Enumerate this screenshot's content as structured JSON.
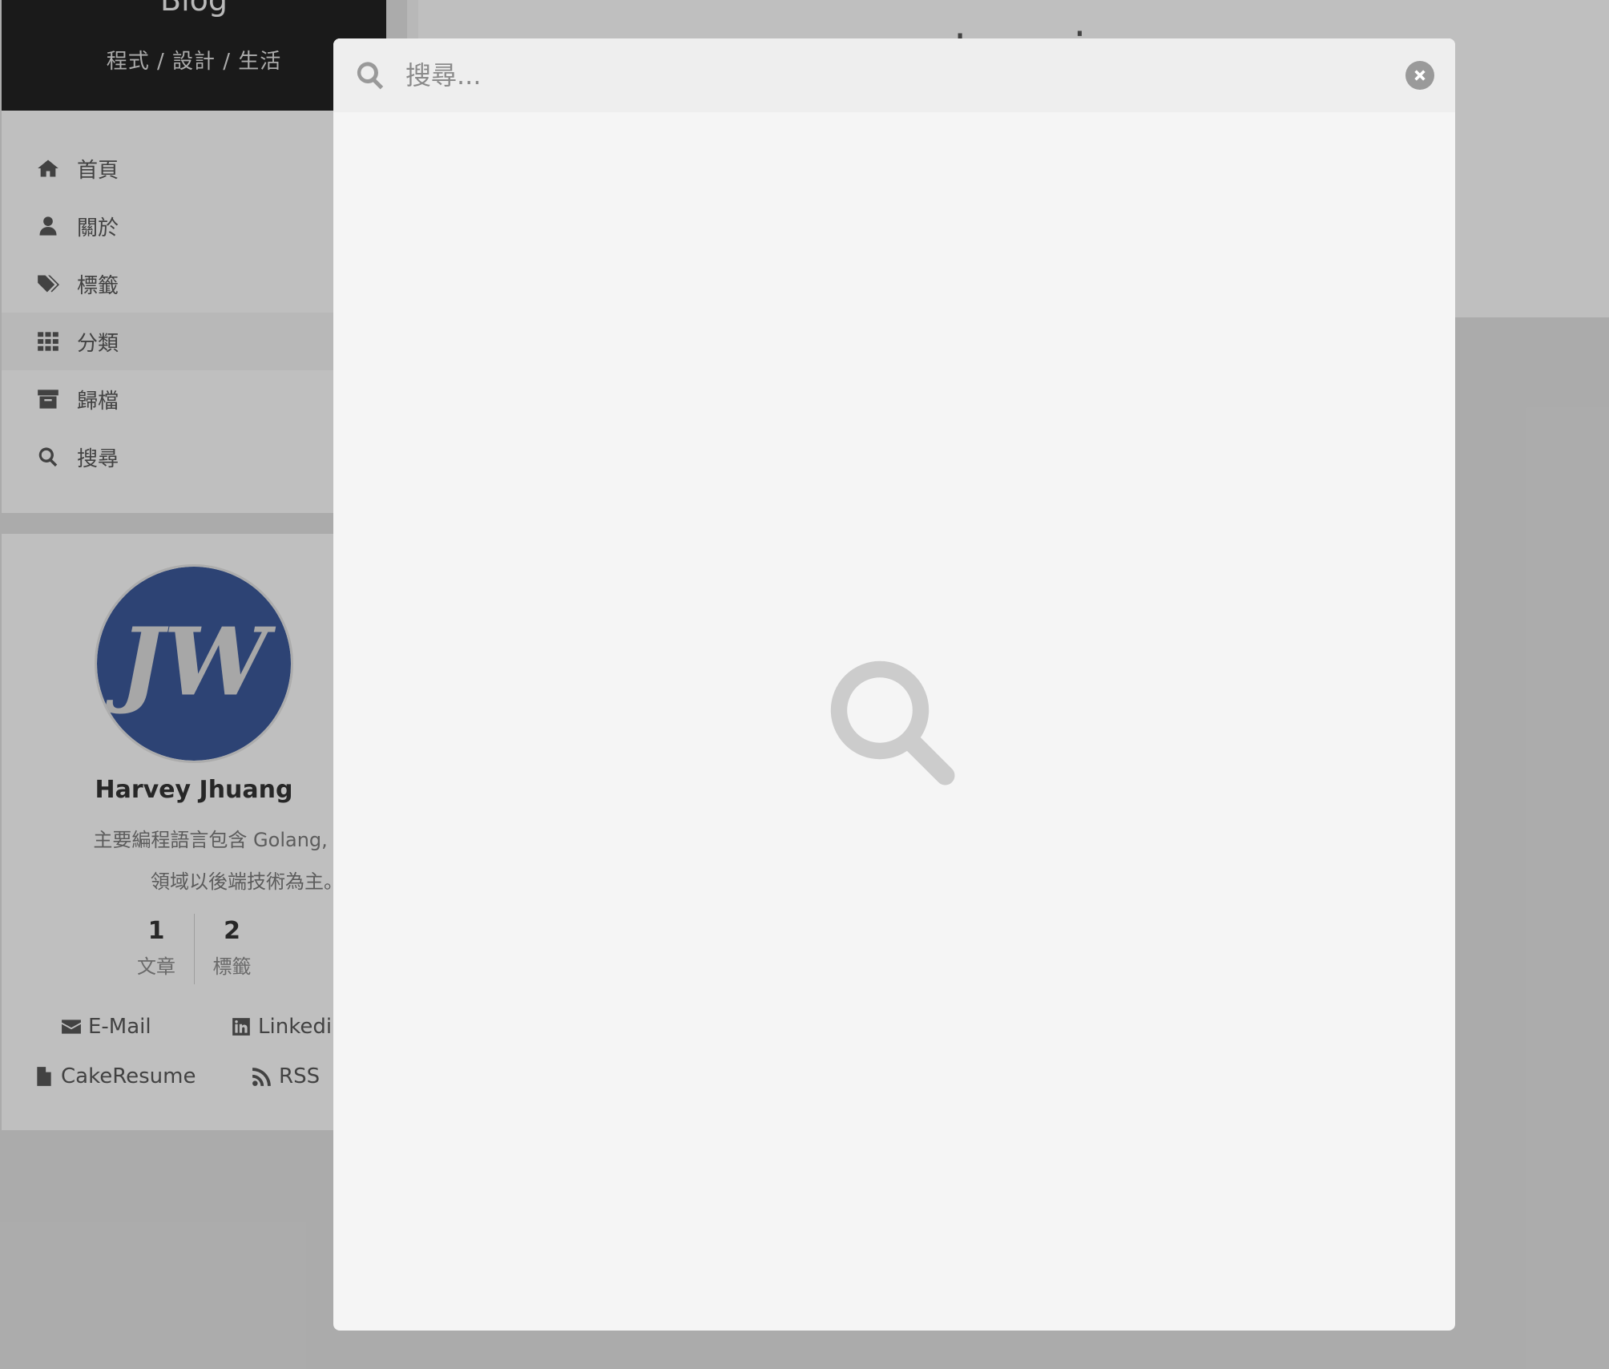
{
  "site": {
    "title": "Blog",
    "subtitle": "程式 / 設計 / 生活"
  },
  "menu": {
    "items": [
      {
        "label": "首頁",
        "icon": "home-icon"
      },
      {
        "label": "關於",
        "icon": "user-icon"
      },
      {
        "label": "標籤",
        "icon": "tags-icon"
      },
      {
        "label": "分類",
        "icon": "th-icon",
        "active": true
      },
      {
        "label": "歸檔",
        "icon": "archive-icon"
      },
      {
        "label": "搜尋",
        "icon": "search-icon"
      }
    ]
  },
  "page": {
    "title": "categories"
  },
  "author": {
    "name": "Harvey Jhuang",
    "description": "主要編程語言包含 Golang, Python\n領域以後端技術為主。",
    "avatar_letters": "JW",
    "avatar_color": "#3a5795"
  },
  "stats": [
    {
      "count": "1",
      "name": "文章"
    },
    {
      "count": "2",
      "name": "標籤"
    }
  ],
  "links": [
    {
      "label": "E-Mail",
      "icon": "envelope-icon"
    },
    {
      "label": "Linkedin",
      "icon": "linkedin-icon"
    },
    {
      "label": "CakeResume",
      "icon": "file-icon"
    },
    {
      "label": "RSS",
      "icon": "rss-icon"
    }
  ],
  "search_popup": {
    "placeholder": "搜尋...",
    "value": ""
  },
  "colors": {
    "brand_bg": "#222222",
    "sidebar_bg": "#f5f5f5",
    "overlay": "rgba(0,0,0,0.22)",
    "placeholder_icon": "#cccccc"
  }
}
